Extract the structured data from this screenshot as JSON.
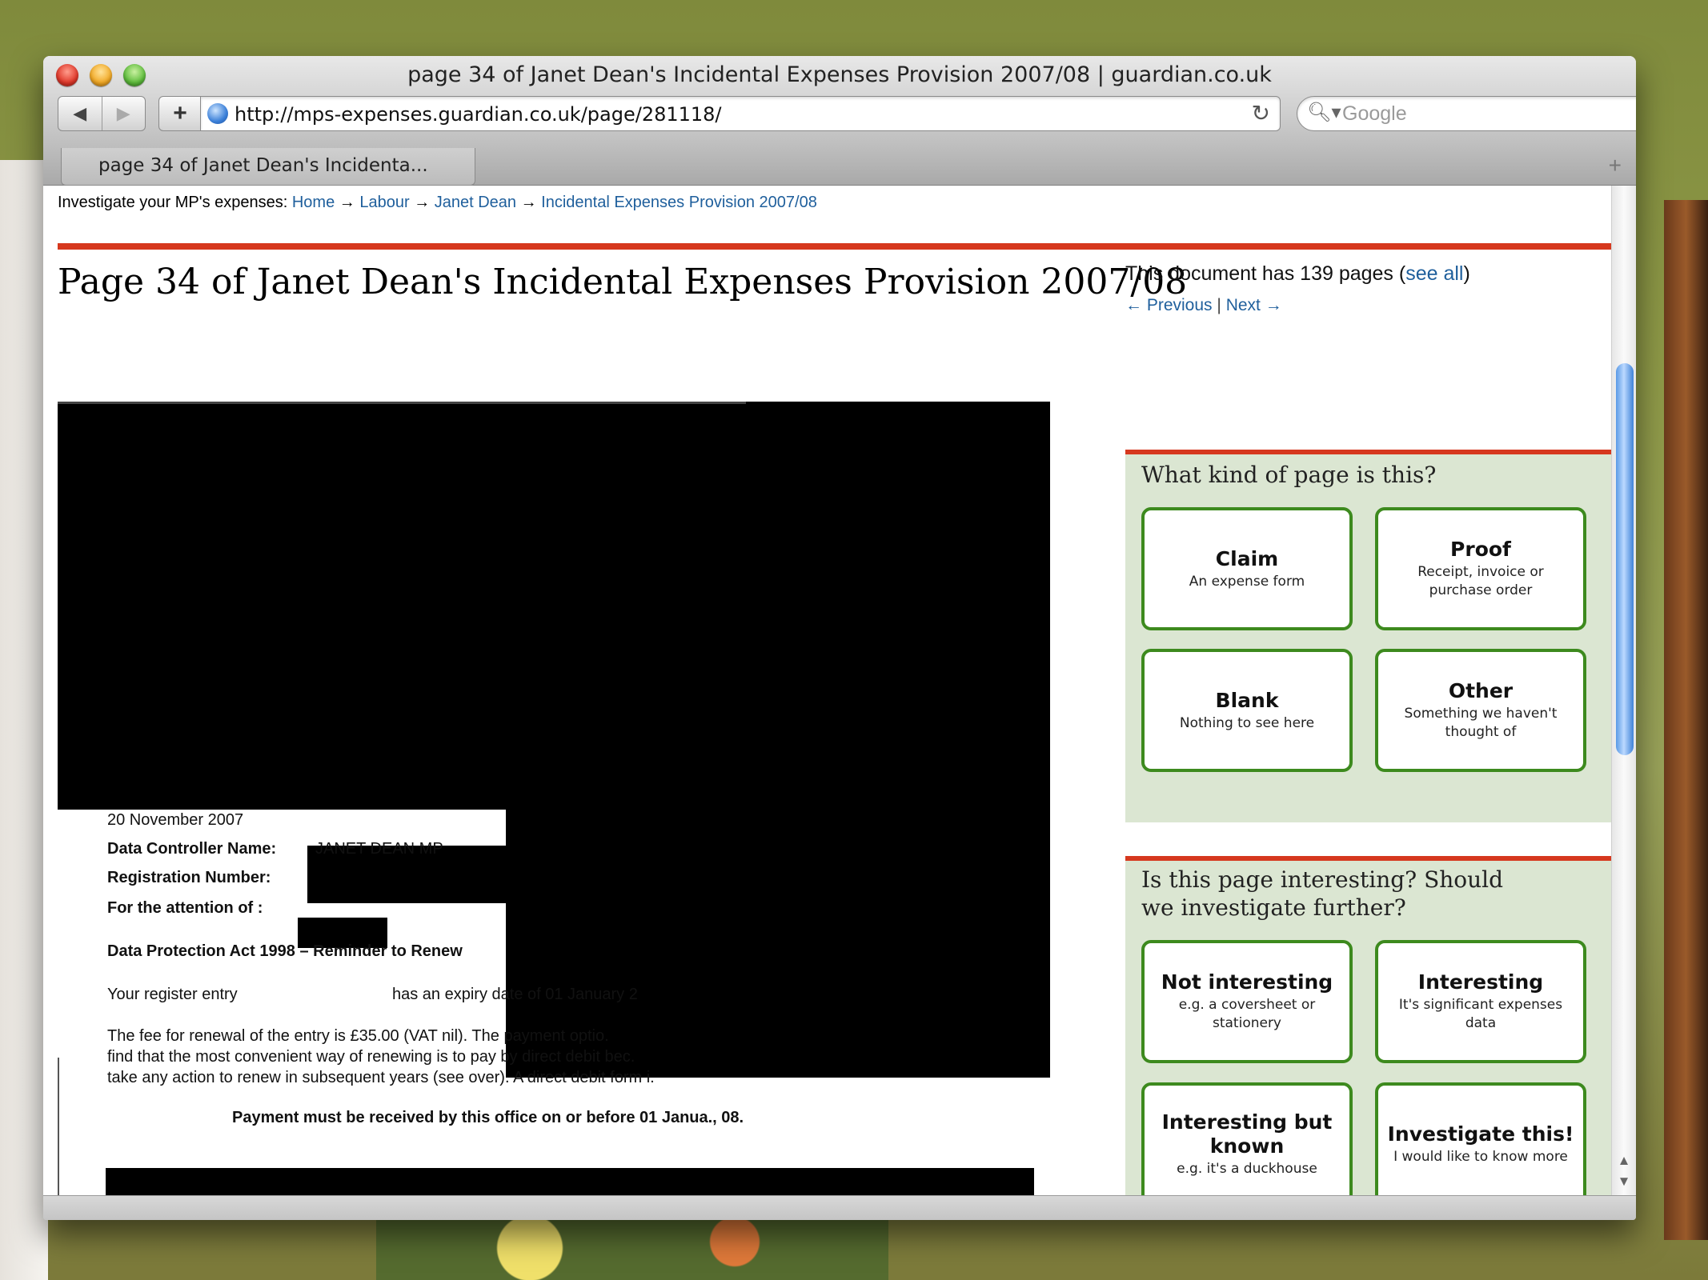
{
  "window": {
    "title": "page 34 of Janet Dean's Incidental Expenses Provision 2007/08 | guardian.co.uk",
    "url": "http://mps-expenses.guardian.co.uk/page/281118/",
    "search_placeholder": "Google",
    "tab_label": "page 34 of Janet Dean's Incidenta...",
    "icons": [
      "back-icon",
      "forward-icon",
      "add-bookmark-icon",
      "globe-icon",
      "reload-icon",
      "search-icon",
      "new-tab-icon"
    ]
  },
  "breadcrumb": {
    "prefix": "Investigate your MP's expenses:",
    "items": [
      "Home",
      "Labour",
      "Janet Dean",
      "Incidental Expenses Provision 2007/08"
    ],
    "separator": "→"
  },
  "page": {
    "title": "Page 34 of Janet Dean's Incidental Expenses Provision 2007/08",
    "doc_info_text": "This document has 139 pages (",
    "see_all": "see all",
    "doc_info_close": ")",
    "previous": "← Previous",
    "pipe": "|",
    "next": "Next →"
  },
  "scan": {
    "date": "20 November 2007",
    "controller_label": "Data Controller Name:",
    "controller_value": "JANET DEAN MP",
    "registration_label": "Registration Number:",
    "attention_label": "For the attention of :",
    "heading": "Data Protection Act 1998 – Reminder to Renew",
    "entry_prefix": "Your register entry",
    "entry_suffix": "has an expiry date of 01 January 2",
    "fee_line1": "The fee for renewal of the entry is £35.00 (VAT nil). The payment optio.",
    "fee_line2": "find that the most convenient way of renewing is to pay by direct debit bec.",
    "fee_line3": "take any action to renew in subsequent years (see over). A direct debit form i.",
    "payment_line": "Payment must be received by this office on or before 01 Janua.,      08."
  },
  "panel_kind": {
    "question": "What kind of page is this?",
    "options": [
      {
        "label": "Claim",
        "desc": "An expense form"
      },
      {
        "label": "Proof",
        "desc": "Receipt, invoice or purchase order"
      },
      {
        "label": "Blank",
        "desc": "Nothing to see here"
      },
      {
        "label": "Other",
        "desc": "Something we haven't thought of"
      }
    ]
  },
  "panel_interest": {
    "question": "Is this page interesting? Should we investigate further?",
    "options": [
      {
        "label": "Not interesting",
        "desc": "e.g. a coversheet or stationery"
      },
      {
        "label": "Interesting",
        "desc": "It's significant expenses data"
      },
      {
        "label": "Interesting but known",
        "desc": "e.g. it's a duckhouse"
      },
      {
        "label": "Investigate this!",
        "desc": "I would like to know more"
      }
    ]
  },
  "colors": {
    "accent_red": "#d6381e",
    "link_blue": "#1f5f9c",
    "panel_green": "#dbe6d2",
    "button_border_green": "#3d8a1e"
  }
}
